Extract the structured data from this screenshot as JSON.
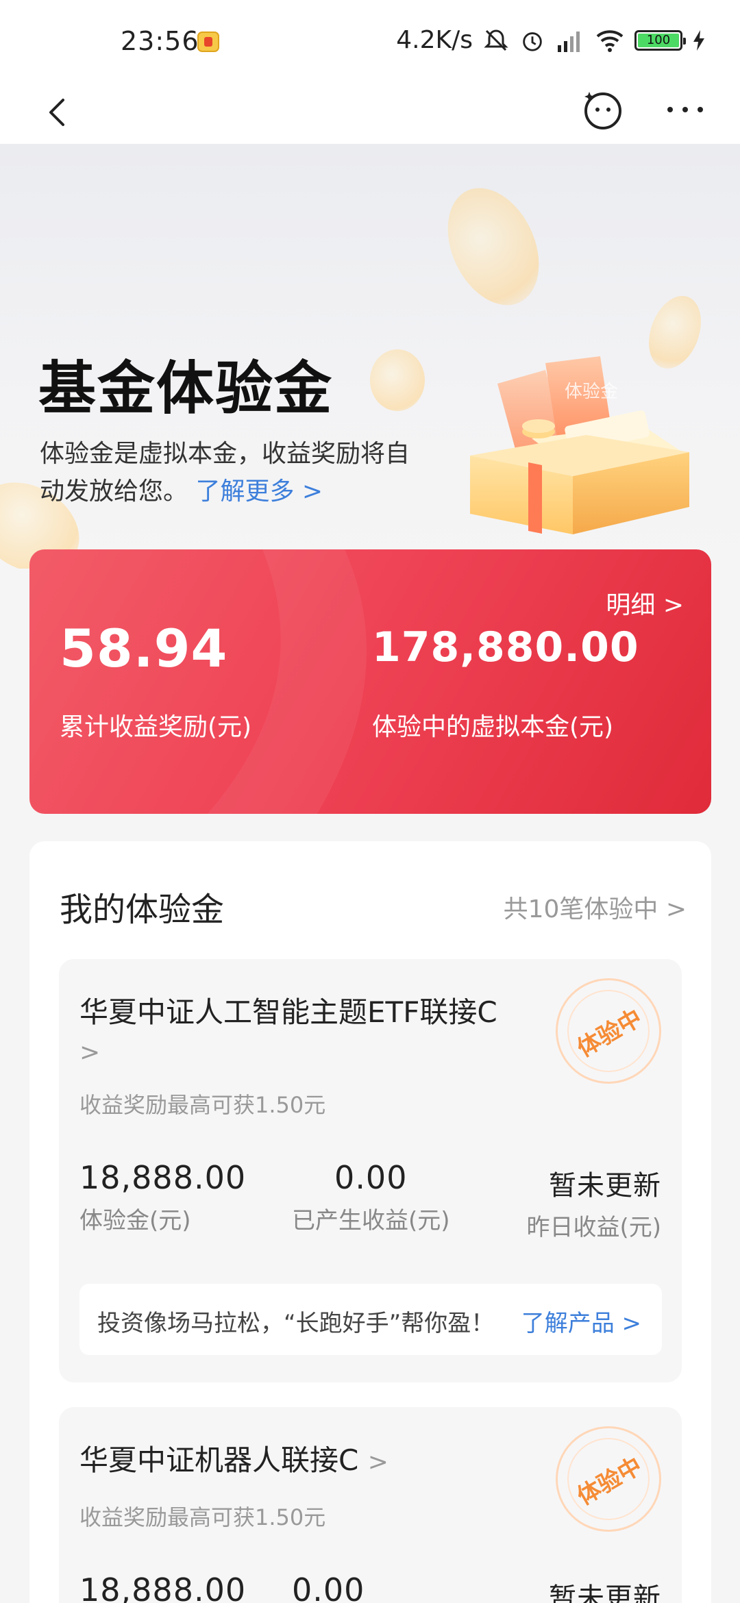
{
  "status_bar": {
    "time": "23:56",
    "net_speed": "4.2K/s",
    "battery": "100"
  },
  "hero": {
    "title": "基金体验金",
    "desc": "体验金是虚拟本金，收益奖励将自动发放给您。",
    "link": "了解更多 >",
    "coupon_label": "体验金"
  },
  "summary_card": {
    "detail_link": "明细 >",
    "total_reward_value": "58.94",
    "total_reward_label": "累计收益奖励(元)",
    "principal_value": "178,880.00",
    "principal_label": "体验中的虚拟本金(元)"
  },
  "my_section": {
    "title": "我的体验金",
    "summary": "共10笔体验中 >"
  },
  "funds": [
    {
      "name": "华夏中证人工智能主题ETF联接C",
      "chevron": ">",
      "sub": "收益奖励最高可获1.50元",
      "stamp": "体验中",
      "amount": "18,888.00",
      "amount_label": "体验金(元)",
      "earned": "0.00",
      "earned_label": "已产生收益(元)",
      "yesterday": "暂未更新",
      "yesterday_label": "昨日收益(元)",
      "promo_text": "投资像场马拉松，“长跑好手”帮你盈！",
      "promo_link": "了解产品 >"
    },
    {
      "name": "华夏中证机器人联接C",
      "chevron": ">",
      "sub": "收益奖励最高可获1.50元",
      "stamp": "体验中",
      "amount": "18,888.00",
      "earned": "0.00",
      "yesterday": "暂未更新"
    }
  ],
  "colors": {
    "accent_red": "#ef4456",
    "link_blue": "#3d7fdb",
    "stamp_orange": "#f58b35"
  },
  "icons": [
    "back-arrow-icon",
    "face-assistant-icon",
    "more-icon",
    "chevron-right-icon"
  ]
}
